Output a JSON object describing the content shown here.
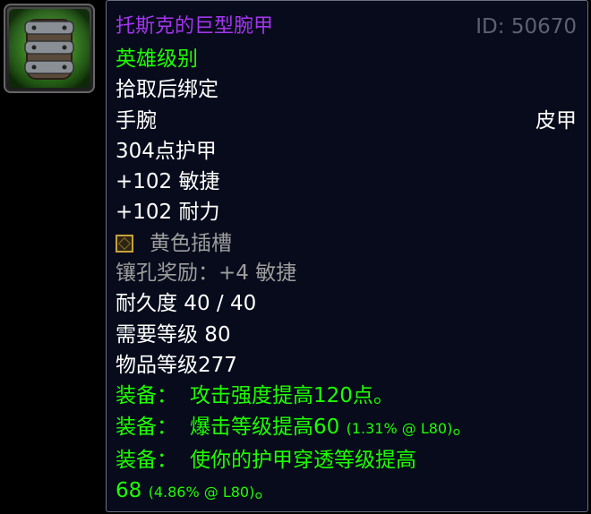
{
  "item": {
    "name": "托斯克的巨型腕甲",
    "id_label": "ID: 50670",
    "quality": "英雄级别",
    "binding": "拾取后绑定",
    "slot": "手腕",
    "armor_type": "皮甲",
    "armor": "304点护甲",
    "stats": [
      "+102 敏捷",
      "+102 耐力"
    ],
    "socket": {
      "icon": "yellow-socket-icon",
      "label": "黄色插槽"
    },
    "socket_bonus": "镶孔奖励：+4 敏捷",
    "durability": "耐久度 40 / 40",
    "required_level": "需要等级 80",
    "item_level": "物品等级277",
    "equip_effects": [
      {
        "label": "装备：",
        "text": "攻击强度提高120点。"
      },
      {
        "label": "装备：",
        "text": "爆击等级提高60",
        "detail": "(1.31% @ L80)",
        "end": "。"
      },
      {
        "label": "装备：",
        "text": "使你的护甲穿透等级提高",
        "text2": "68",
        "detail": "(4.86% @ L80)",
        "end": "。"
      }
    ]
  },
  "icon": {
    "name": "bracer-icon"
  },
  "colors": {
    "epic": "#a335ee",
    "uncommon": "#1eff00",
    "grey": "#9d9d9d",
    "background": "#070b1b"
  }
}
